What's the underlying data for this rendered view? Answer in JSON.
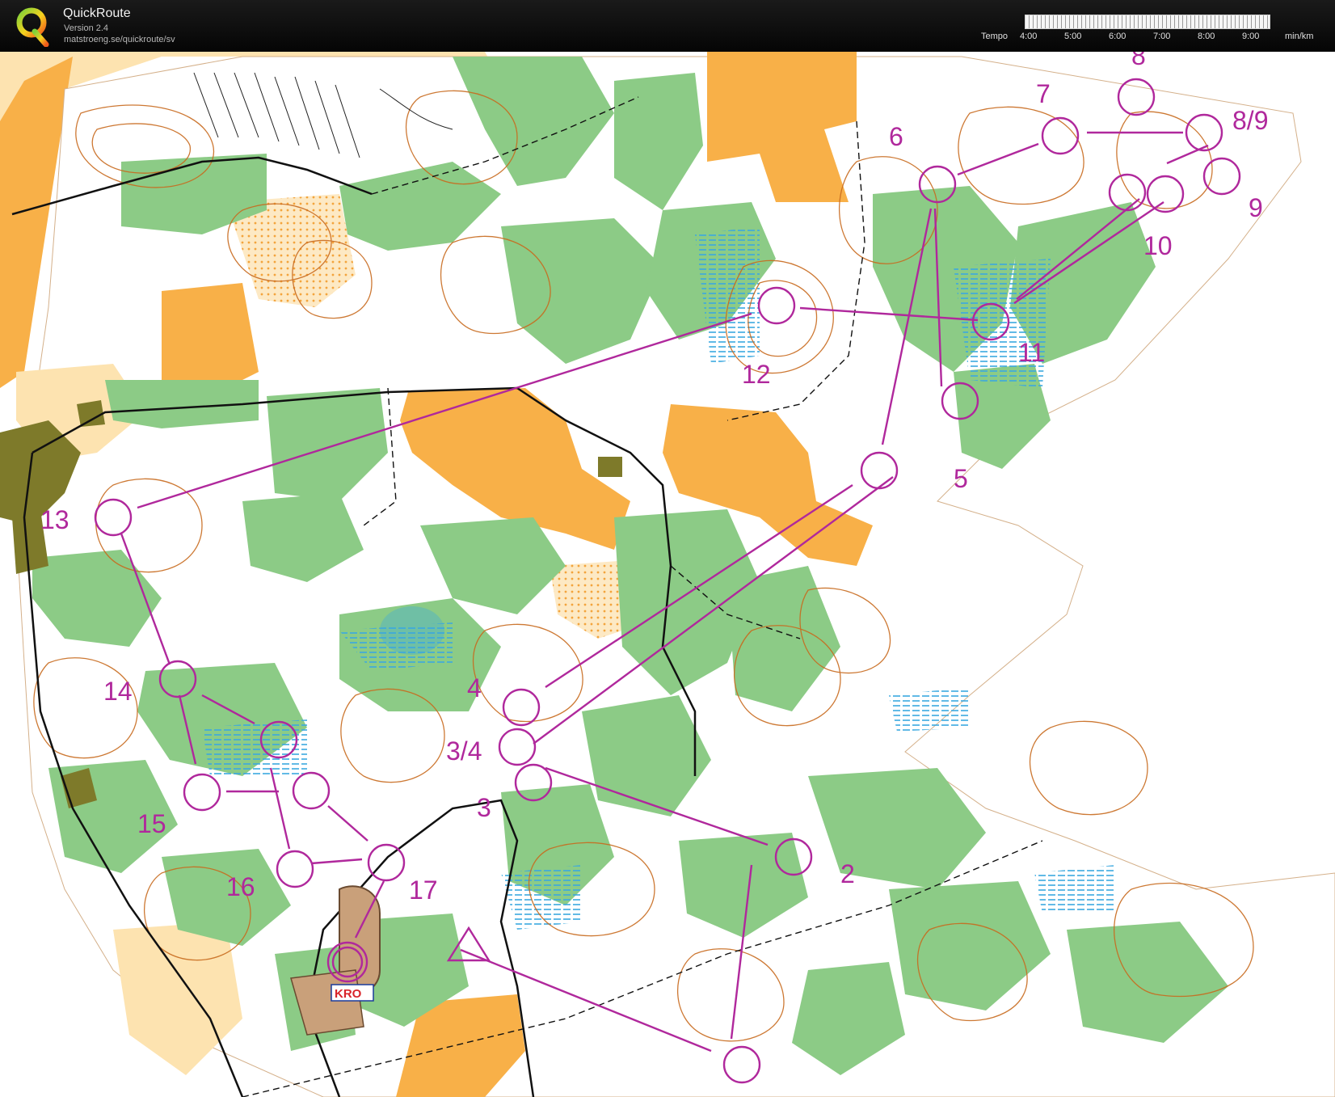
{
  "app": {
    "name": "QuickRoute",
    "version": "Version 2.4",
    "url": "matstroeng.se/quickroute/sv",
    "logo_letter": "Q"
  },
  "tempo": {
    "label": "Tempo",
    "ticks": [
      "4:00",
      "5:00",
      "6:00",
      "7:00",
      "8:00",
      "9:00"
    ],
    "unit": "min/km"
  },
  "map": {
    "colors": {
      "course": "#b0289c",
      "open": "#f8b048",
      "forest": "#8ccb86",
      "water": "#3aa8e0",
      "contour": "#c86a1e",
      "settlement": "#7e7a2a"
    },
    "controls": [
      "2",
      "3",
      "3/4",
      "4",
      "5",
      "6",
      "7",
      "8",
      "8/9",
      "9",
      "10",
      "11",
      "12",
      "13",
      "14",
      "15",
      "16",
      "17"
    ],
    "logo_text": "KRO"
  }
}
